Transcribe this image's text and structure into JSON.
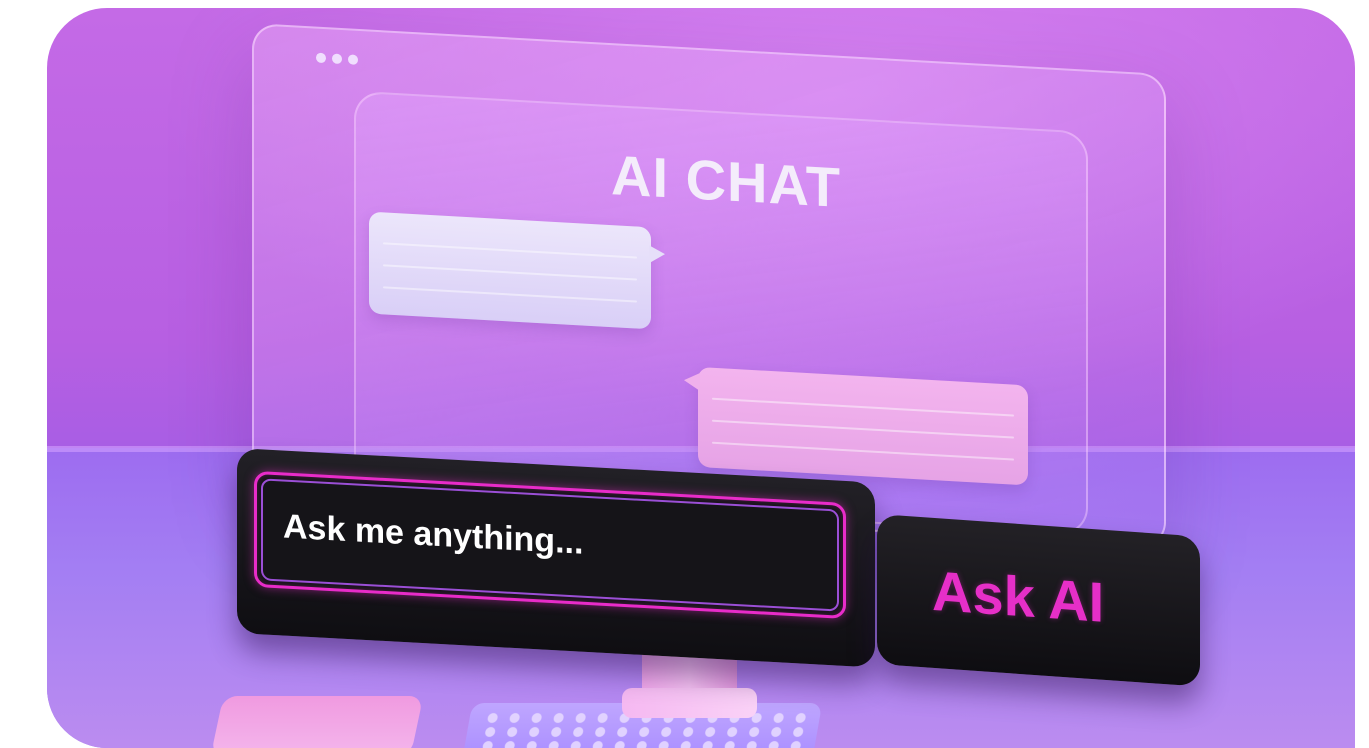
{
  "scene": {
    "title": "AI CHAT",
    "window_dots": [
      "dot-1",
      "dot-2",
      "dot-3"
    ]
  },
  "chat": {
    "input_text": "Ask me anything...",
    "button_label": "Ask AI"
  },
  "colors": {
    "background": "#b75fe2",
    "accent_pink": "#e62fc8",
    "input_border": "#e82cc9",
    "bar_dark": "#151418",
    "bubble_user": "#e6dff9",
    "bubble_ai": "#f0b0ec"
  }
}
